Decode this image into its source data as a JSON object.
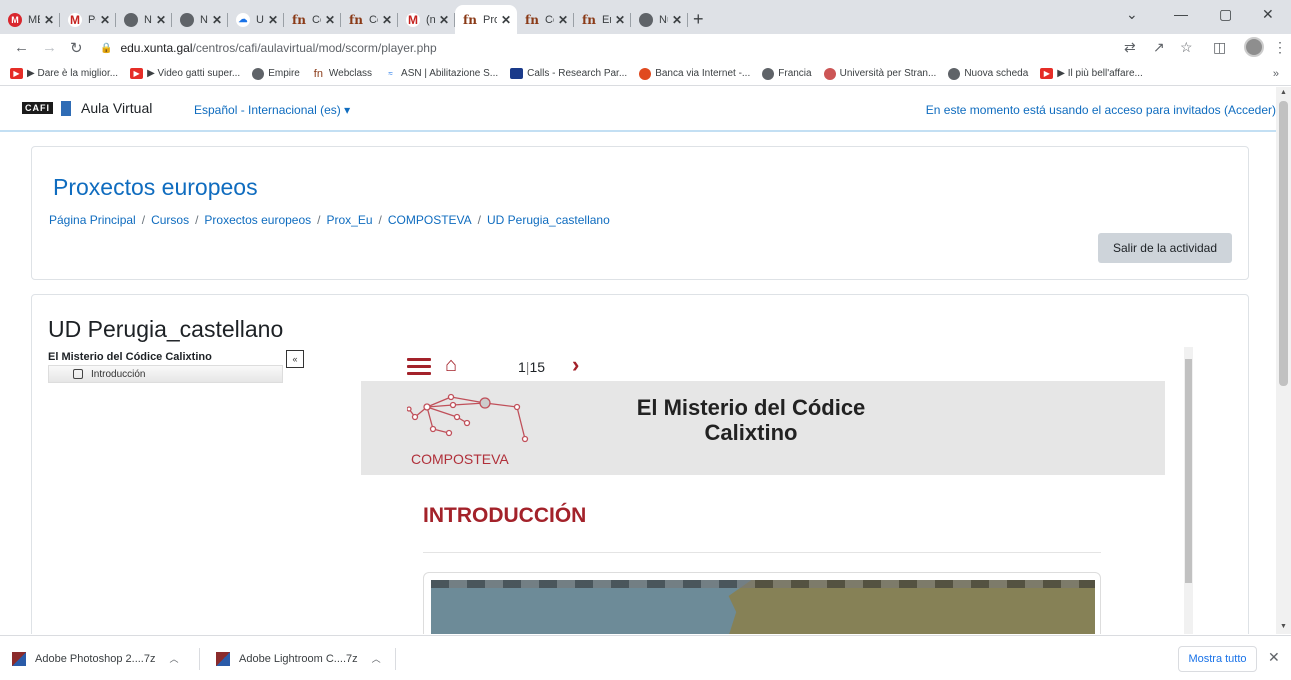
{
  "browser": {
    "tabs": [
      {
        "title": "MEGA",
        "favicon": "mega-icon"
      },
      {
        "title": "Posta in",
        "favicon": "gmail-icon"
      },
      {
        "title": "Nuova",
        "favicon": "globe-icon"
      },
      {
        "title": "Nuova",
        "favicon": "globe-icon"
      },
      {
        "title": "Unità D",
        "favicon": "unita-icon"
      },
      {
        "title": "Centro",
        "favicon": "fn-icon"
      },
      {
        "title": "Centro",
        "favicon": "fn-icon"
      },
      {
        "title": "(nessun",
        "favicon": "gmail-icon"
      },
      {
        "title": "Prox_Eu",
        "favicon": "fn-icon",
        "active": true
      },
      {
        "title": "Centro",
        "favicon": "fn-icon"
      },
      {
        "title": "Error",
        "favicon": "fn-icon"
      },
      {
        "title": "Nuova",
        "favicon": "globe-icon"
      }
    ],
    "url_host": "edu.xunta.gal",
    "url_path": "/centros/cafi/aulavirtual/mod/scorm/player.php",
    "bookmarks": [
      {
        "label": "▶ Dare è la miglior...",
        "icon": "youtube-icon"
      },
      {
        "label": "▶ Video gatti super...",
        "icon": "youtube-icon"
      },
      {
        "label": "Empire",
        "icon": "globe-icon"
      },
      {
        "label": "Webclass",
        "icon": "fn-icon"
      },
      {
        "label": "ASN | Abilitazione S...",
        "icon": "asn-icon"
      },
      {
        "label": "Calls - Research Par...",
        "icon": "calls-icon"
      },
      {
        "label": "Banca via Internet -...",
        "icon": "banca-icon"
      },
      {
        "label": "Francia",
        "icon": "globe-icon"
      },
      {
        "label": "Università per Stran...",
        "icon": "unistrapg-icon"
      },
      {
        "label": "Nuova scheda",
        "icon": "globe-icon"
      },
      {
        "label": "▶ Il più bell'affare...",
        "icon": "youtube-icon"
      }
    ],
    "bookmarks_more": "»"
  },
  "moodle": {
    "logo_text": "CAFI",
    "site_name": "Aula Virtual",
    "language": "Español - Internacional (es) ▾",
    "guest_text": "En este momento está usando el acceso para invitados (",
    "login_link": "Acceder",
    "guest_close": ")",
    "course_title": "Proxectos europeos",
    "breadcrumb": [
      "Página Principal",
      "Cursos",
      "Proxectos europeos",
      "Prox_Eu",
      "COMPOSTEVA",
      "UD Perugia_castellano"
    ],
    "breadcrumb_sep": "/",
    "exit_button": "Salir de la actividad",
    "activity_title": "UD Perugia_castellano",
    "toc_title": "El Misterio del Códice Calixtino",
    "toc_item": "Introducción",
    "toc_toggle": "«"
  },
  "scorm": {
    "page_current": "1",
    "page_total": "15",
    "banner_title": "El Misterio del Códice Calixtino",
    "logo_text": "COMPOSTEVA",
    "section_heading": "INTRODUCCIÓN"
  },
  "downloads": {
    "items": [
      "Adobe Photoshop 2....7z",
      "Adobe Lightroom C....7z"
    ],
    "show_all": "Mostra tutto"
  },
  "colors": {
    "moodle_blue": "#0f6cbf",
    "scorm_red": "#a3222a",
    "chrome_tabstrip": "#dee1e6"
  }
}
